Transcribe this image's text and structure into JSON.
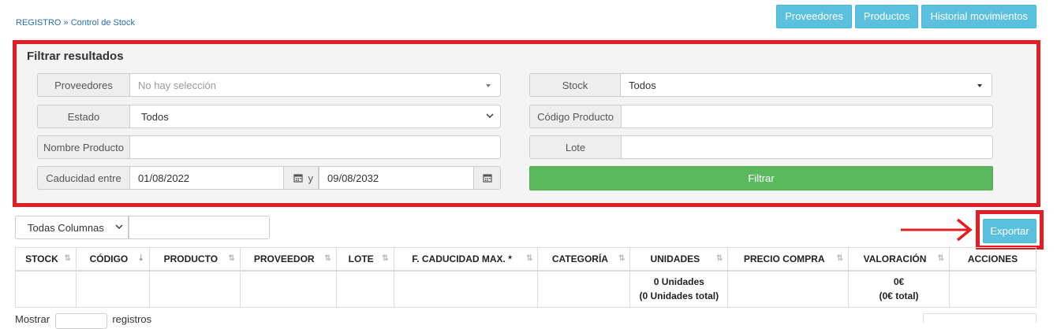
{
  "breadcrumb": {
    "root": "REGISTRO",
    "sep": " » ",
    "current": "Control de Stock"
  },
  "top_buttons": [
    "Proveedores",
    "Productos",
    "Historial movimientos"
  ],
  "filter": {
    "title": "Filtrar resultados",
    "proveedores_label": "Proveedores",
    "proveedores_placeholder": "No hay selección",
    "estado_label": "Estado",
    "estado_value": "Todos",
    "nombre_label": "Nombre Producto",
    "caducidad_label": "Caducidad entre",
    "fecha_desde": "01/08/2022",
    "y_label": "y",
    "fecha_hasta": "09/08/2032",
    "stock_label": "Stock",
    "stock_value": "Todos",
    "codigo_label": "Código Producto",
    "lote_label": "Lote",
    "filtrar_label": "Filtrar"
  },
  "table_controls": {
    "column_select": "Todas Columnas",
    "export_label": "Exportar"
  },
  "table": {
    "headers": [
      "STOCK",
      "CÓDIGO",
      "PRODUCTO",
      "PROVEEDOR",
      "LOTE",
      "F. CADUCIDAD MAX. *",
      "CATEGORÍA",
      "UNIDADES",
      "PRECIO COMPRA",
      "VALORACIÓN",
      "ACCIONES"
    ],
    "totals": {
      "unidades_1": "0 Unidades",
      "unidades_2": "(0 Unidades total)",
      "valoracion_1": "0€",
      "valoracion_2": "(0€ total)"
    }
  },
  "footer": {
    "mostrar": "Mostrar",
    "registros": "registros"
  },
  "colors": {
    "accent_info": "#5bc0de",
    "accent_success": "#5cb85c",
    "highlight_red": "#e21d24"
  }
}
